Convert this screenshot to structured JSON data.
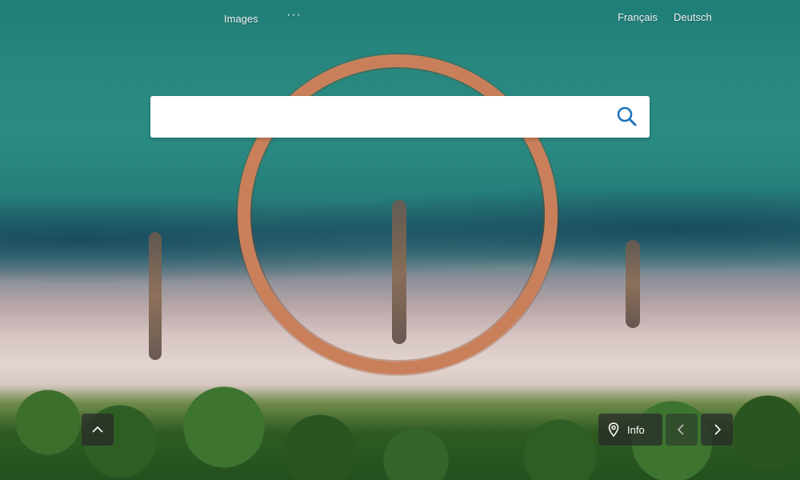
{
  "nav": {
    "images_label": "Images",
    "more_label": "···"
  },
  "languages": [
    {
      "label": "Français"
    },
    {
      "label": "Deutsch"
    }
  ],
  "search": {
    "value": "",
    "placeholder": "",
    "icon": "search-icon"
  },
  "controls": {
    "scroll_up_icon": "chevron-up-icon",
    "info_icon": "map-pin-icon",
    "info_label": "Info",
    "prev_icon": "chevron-left-icon",
    "next_icon": "chevron-right-icon"
  },
  "colors": {
    "accent": "#1e73be"
  }
}
